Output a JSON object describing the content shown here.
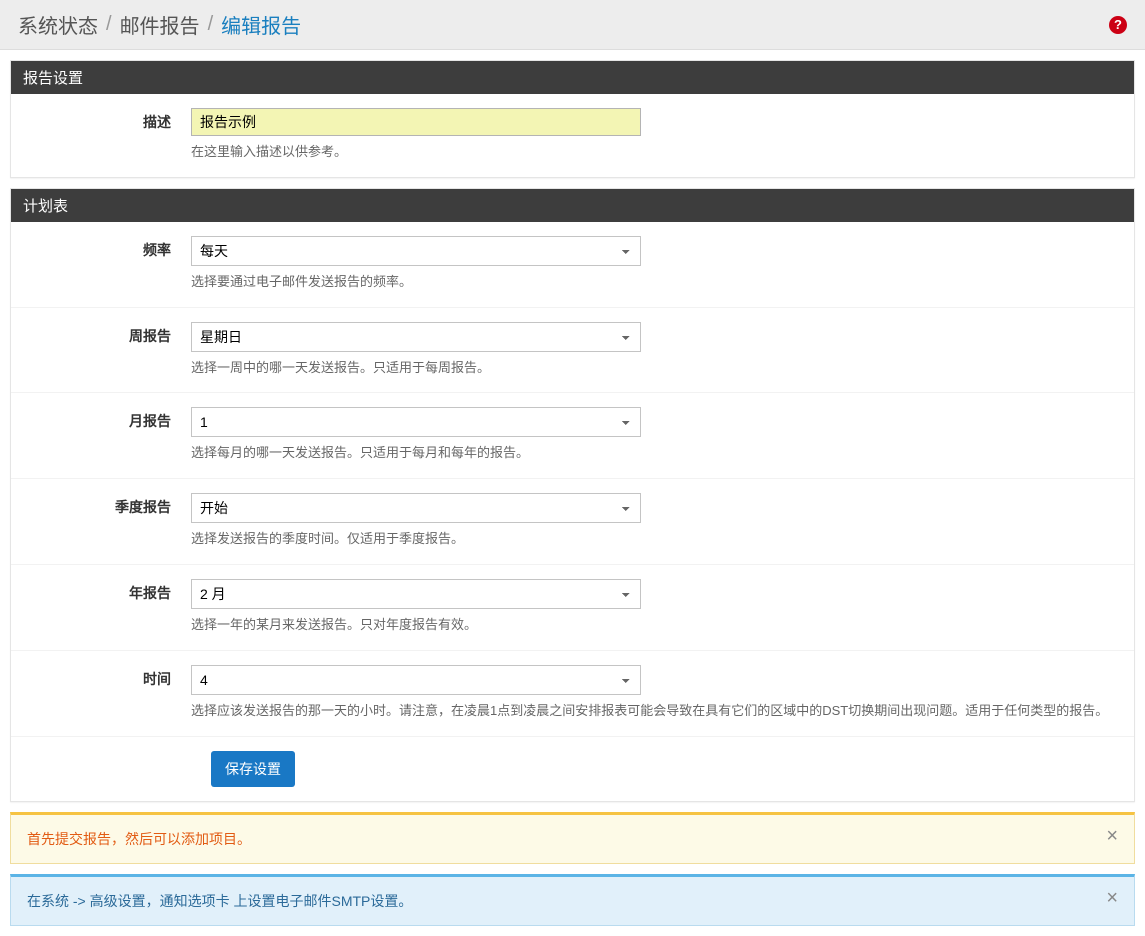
{
  "breadcrumb": {
    "item1": "系统状态",
    "item2": "邮件报告",
    "item3": "编辑报告"
  },
  "help_icon_label": "?",
  "panel_settings": {
    "title": "报告设置",
    "description": {
      "label": "描述",
      "value": "报告示例",
      "help": "在这里输入描述以供参考。"
    }
  },
  "panel_schedule": {
    "title": "计划表",
    "frequency": {
      "label": "频率",
      "value": "每天",
      "help": "选择要通过电子邮件发送报告的频率。"
    },
    "week_report": {
      "label": "周报告",
      "value": "星期日",
      "help": "选择一周中的哪一天发送报告。只适用于每周报告。"
    },
    "month_report": {
      "label": "月报告",
      "value": "1",
      "help": "选择每月的哪一天发送报告。只适用于每月和每年的报告。"
    },
    "quarter_report": {
      "label": "季度报告",
      "value": "开始",
      "help": "选择发送报告的季度时间。仅适用于季度报告。"
    },
    "year_report": {
      "label": "年报告",
      "value": "2 月",
      "help": "选择一年的某月来发送报告。只对年度报告有效。"
    },
    "time": {
      "label": "时间",
      "value": "4",
      "help": "选择应该发送报告的那一天的小时。请注意，在凌晨1点到凌晨之间安排报表可能会导致在具有它们的区域中的DST切换期间出现问题。适用于任何类型的报告。"
    },
    "save_button": "保存设置"
  },
  "alerts": {
    "warning": "首先提交报告，然后可以添加项目。",
    "info": "在系统 -> 高级设置，通知选项卡 上设置电子邮件SMTP设置。",
    "close_label": "×"
  }
}
